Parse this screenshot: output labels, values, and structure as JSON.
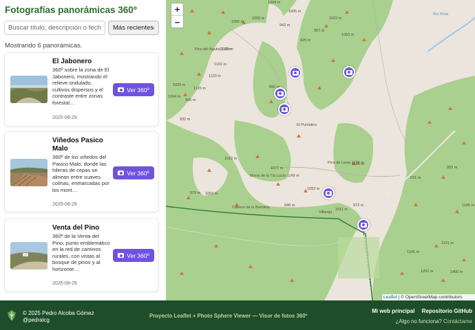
{
  "sidebar": {
    "title": "Fotografías panorámicas 360º",
    "search_placeholder": "Buscar título, descripción o fecha...",
    "sort_selected": "Más recientes",
    "count_text": "Mostrando 6 panorámicas."
  },
  "cards": [
    {
      "title": "El Jabonero",
      "description": "360º sobre la zona de El Jabonero, mostrando el relieve ondulado, cultivos dispersos y el contraste entre zonas forestal…",
      "date": "2025-08-29",
      "button": "Ver 360º"
    },
    {
      "title": "Viñedos Pasico Malo",
      "description": "360º de los viñedos del Pasico Malo, donde las hileras de cepas se alinean entre suaves colinas, enmarcadas por los mont…",
      "date": "2025-08-29",
      "button": "Ver 360º"
    },
    {
      "title": "Venta del Pino",
      "description": "360º de la Venta del Pino, punto emblemático en la red de caminos rurales, con vistas al bosque de pinos y al horizonte…",
      "date": "2025-08-29",
      "button": "Ver 360º"
    }
  ],
  "map": {
    "zoom_in": "+",
    "zoom_out": "−",
    "attribution_leaflet": "Leaflet",
    "attribution_rest": "| © OpenStreetMap contributors",
    "labels": [
      "1004 m",
      "1005 m",
      "1066 m",
      "1099 m",
      "942 m",
      "957 m",
      "925 m",
      "1022 m",
      "1053 m",
      "Pico del Águila 1139 m",
      "1123 m",
      "1101 m",
      "1125 m",
      "1125 m",
      "1025 m",
      "1094 m",
      "995 m",
      "932 m",
      "896 m",
      "El Puntalico",
      "1012 m",
      "1077 m",
      "Morra de la Tía Lucía 1149 m",
      "Pico de Lavia 1236 m",
      "1166 m",
      "979 m",
      "1007 m",
      "Cabezo de la Bandera",
      "1053 m",
      "946 m",
      "Villarejo",
      "972 m",
      "1011 m",
      "952 m",
      "831 m",
      "1101 m",
      "1145 m",
      "1292 m",
      "1400 m",
      "1185 m",
      "Río Mula"
    ]
  },
  "footer": {
    "copyright": "© 2025 Pedro Alcoba Gómez",
    "handle": "@pedralcg",
    "project": "Proyecto Leaflet + Photo Sphere Viewer — Visor de fotos 360º",
    "link_web": "Mi web principal",
    "link_repo": "Repositorio GitHub",
    "question": "¿Algo no funciona?",
    "contact": "Contáctame"
  }
}
